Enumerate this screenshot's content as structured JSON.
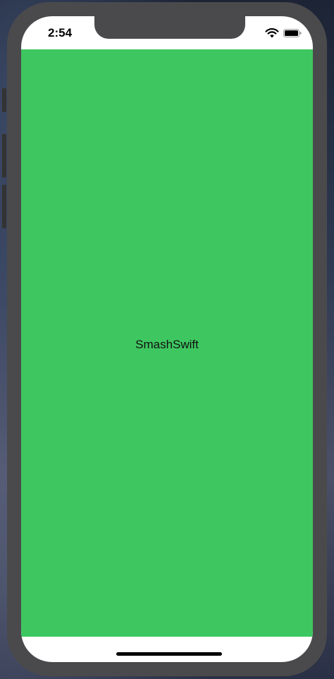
{
  "status_bar": {
    "time": "2:54"
  },
  "screen": {
    "label": "SmashSwift",
    "background_color": "#3ec761"
  },
  "icons": {
    "wifi": "wifi-icon",
    "battery": "battery-icon"
  }
}
